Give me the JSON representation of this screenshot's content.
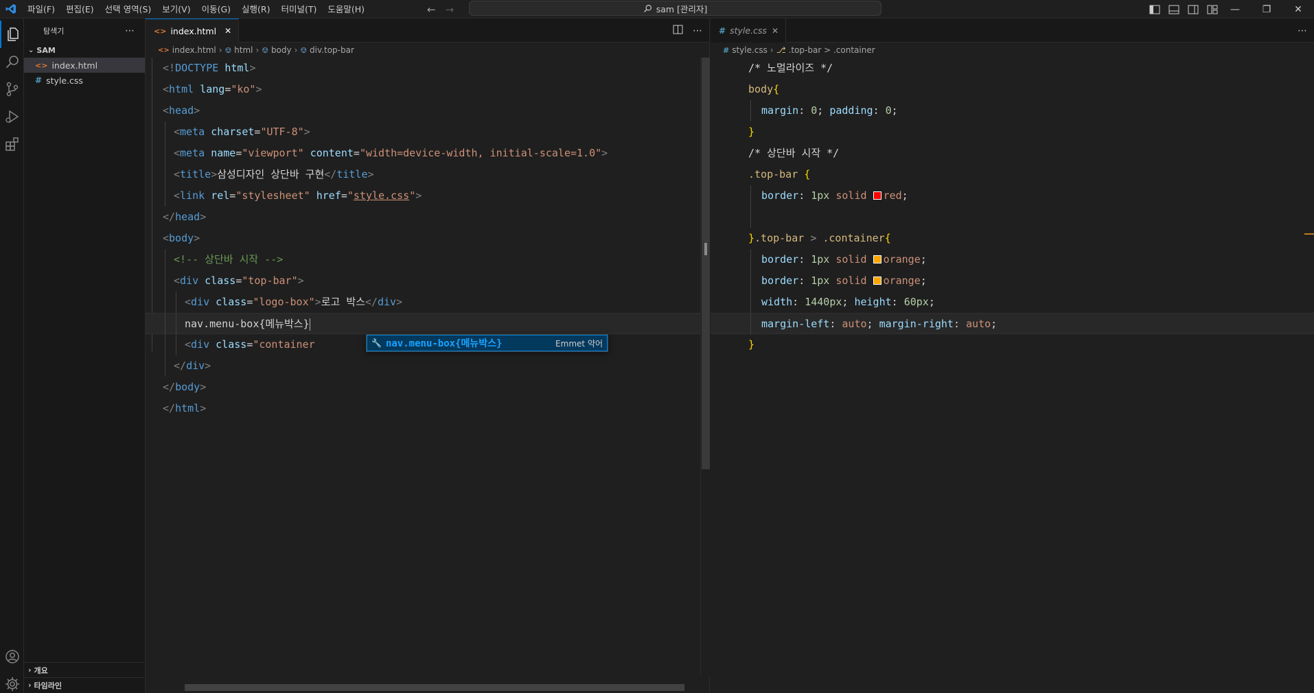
{
  "titlebar": {
    "menu": [
      "파일(F)",
      "편집(E)",
      "선택 영역(S)",
      "보기(V)",
      "이동(G)",
      "실행(R)",
      "터미널(T)",
      "도움말(H)"
    ],
    "search_text": "sam [관리자]"
  },
  "sidebar": {
    "header": "탐색기",
    "folder": "SAM",
    "files": [
      {
        "name": "index.html",
        "type": "html",
        "active": true
      },
      {
        "name": "style.css",
        "type": "css",
        "active": false
      }
    ],
    "outline": "개요",
    "timeline": "타임라인"
  },
  "left_editor": {
    "tab_label": "index.html",
    "breadcrumbs": [
      "index.html",
      "html",
      "body",
      "div.top-bar"
    ],
    "suggestion": {
      "label": "nav.menu-box{메뉴박스}",
      "detail": "Emmet 약어"
    },
    "lines": [
      "<!DOCTYPE html>",
      "<html lang=\"ko\">",
      "<head>",
      "<meta charset=\"UTF-8\">",
      "<meta name=\"viewport\" content=\"width=device-width, initial-scale=1.0\">",
      "<title>삼성디자인 상단바 구현</title>",
      "<link rel=\"stylesheet\" href=\"style.css\">",
      "</head>",
      "<body>",
      "<!-- 상단바 시작 -->",
      "<div class=\"top-bar\">",
      "<div class=\"logo-box\">로고 박스</div>",
      "nav.menu-box{메뉴박스}",
      "<div class=\"container\">",
      "</div>",
      "</body>",
      "</html>"
    ]
  },
  "right_editor": {
    "tab_label": "style.css",
    "breadcrumbs": [
      "style.css",
      ".top-bar > .container"
    ],
    "lines": [
      "/* 노멀라이즈 */",
      "body{",
      "margin: 0; padding: 0;",
      "}",
      "/* 상단바 시작 */",
      ".top-bar {",
      "border: 1px solid red;",
      "",
      "}.top-bar > .container{",
      "border: 1px solid orange;",
      "border: 1px solid orange;",
      "width: 1440px; height: 60px;",
      "margin-left: auto; margin-right: auto;",
      "}"
    ]
  },
  "colors": {
    "accent": "#0078d4",
    "swatch_red": "#ff0000",
    "swatch_orange": "#ffa500"
  }
}
